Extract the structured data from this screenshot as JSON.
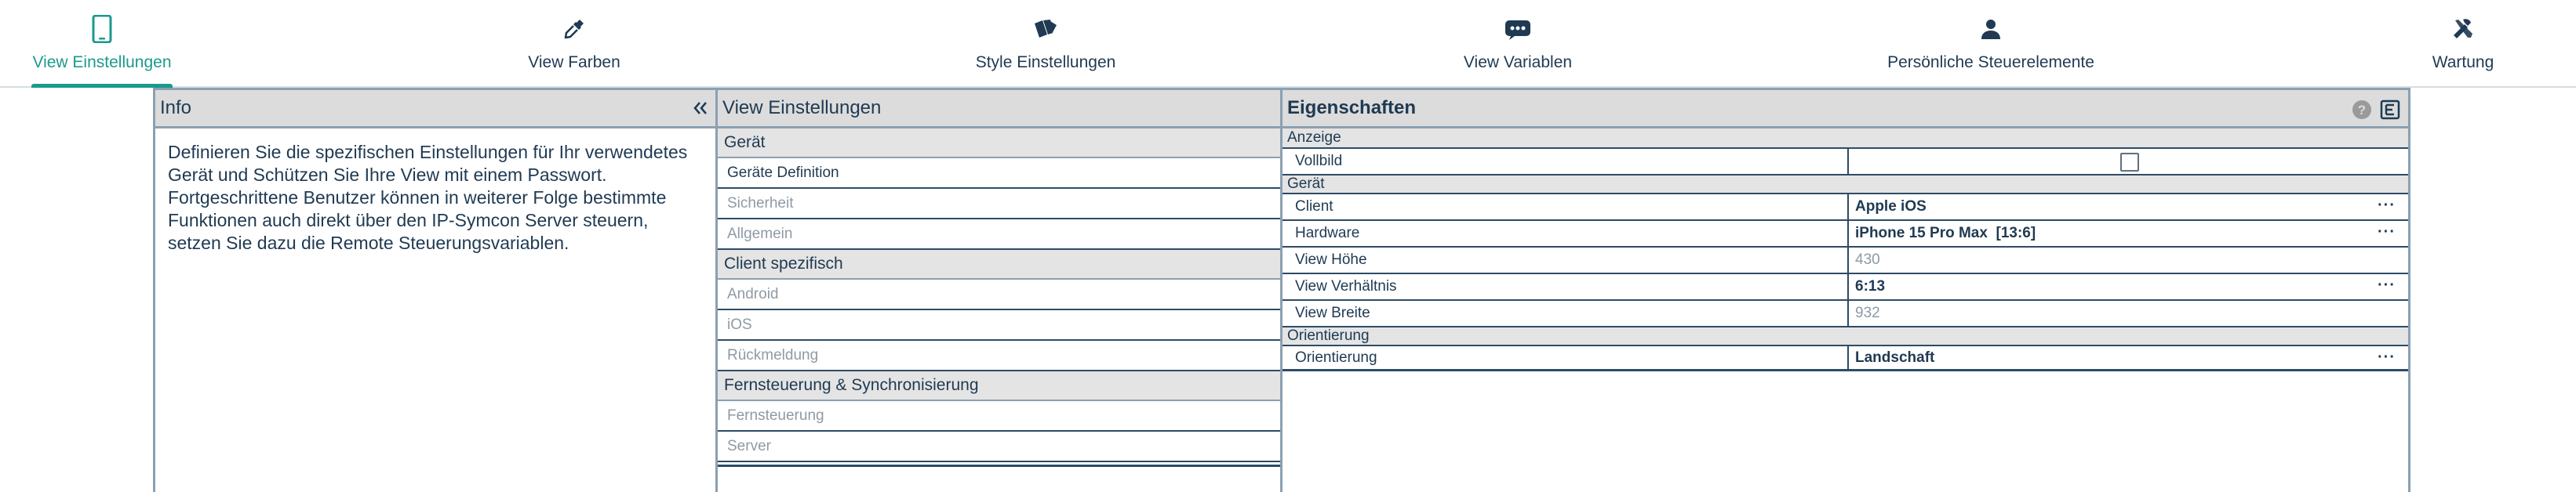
{
  "nav": {
    "tabs": [
      {
        "label": "View Einstellungen",
        "icon": "smartphone-icon",
        "active": true
      },
      {
        "label": "View Farben",
        "icon": "eyedropper-icon"
      },
      {
        "label": "Style Einstellungen",
        "icon": "style-cards-icon"
      },
      {
        "label": "View Variablen",
        "icon": "variables-badge-icon"
      },
      {
        "label": "Persönliche Steuerelemente",
        "icon": "person-icon"
      },
      {
        "label": "Wartung",
        "icon": "tools-icon"
      }
    ]
  },
  "info": {
    "title": "Info",
    "text": "Definieren Sie die spezifischen Einstellungen für Ihr verwendetes Gerät und Schützen Sie Ihre View mit einem Passwort. Fortgeschrittene Benutzer können in weiterer Folge bestimmte Funktionen auch direkt über den IP-Symcon Server steuern, setzen Sie dazu die Remote Steuerungsvariablen."
  },
  "view": {
    "title": "View Einstellungen",
    "sections": [
      {
        "label": "Gerät",
        "items": [
          "Geräte Definition",
          "Sicherheit",
          "Allgemein"
        ]
      },
      {
        "label": "Client spezifisch",
        "items": [
          "Android",
          "iOS",
          "Rückmeldung"
        ]
      },
      {
        "label": "Fernsteuerung & Synchronisierung",
        "items": [
          "Fernsteuerung",
          "Server"
        ]
      }
    ],
    "selected": "Geräte Definition"
  },
  "props": {
    "title": "Eigenschaften",
    "anzeige": {
      "label": "Anzeige",
      "vollbild": "Vollbild"
    },
    "geraet": {
      "label": "Gerät",
      "client_key": "Client",
      "client_val": "Apple iOS",
      "hardware_key": "Hardware",
      "hardware_val": "iPhone 15 Pro Max  [13:6]",
      "hoehe_key": "View Höhe",
      "hoehe_val": "430",
      "verh_key": "View Verhältnis",
      "verh_val": "6:13",
      "breite_key": "View Breite",
      "breite_val": "932"
    },
    "orientierung": {
      "label": "Orientierung",
      "key": "Orientierung",
      "val": "Landschaft"
    },
    "dots": "···"
  },
  "colors": {
    "accent": "#1a9a8c",
    "text": "#1f3a52",
    "border": "#2d4b66",
    "muted": "#8f9aa4"
  }
}
